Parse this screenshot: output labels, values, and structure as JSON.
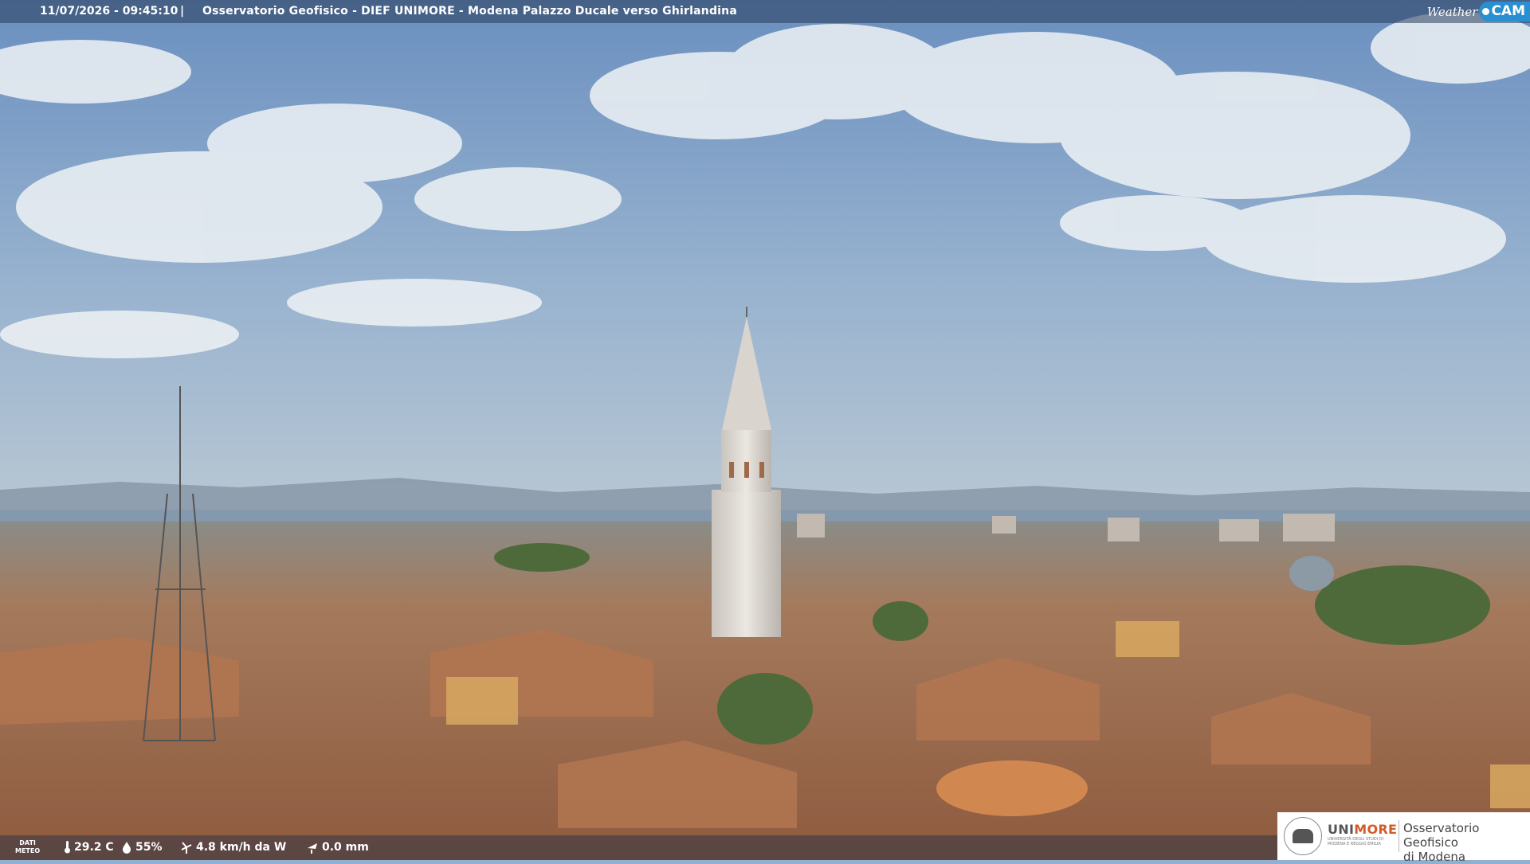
{
  "overlay": {
    "timestamp": "11/07/2026 - 09:45:10",
    "separator": "|",
    "title": "Osservatorio Geofisico - DIEF UNIMORE - Modena Palazzo Ducale verso Ghirlandina"
  },
  "brand": {
    "weather": "Weather",
    "cam": "CAM"
  },
  "meteo": {
    "label_line1": "DATI",
    "label_line2": "METEO",
    "temperature": "29.2 C",
    "humidity": "55%",
    "wind": "4.8 km/h da W",
    "rain": "0.0 mm"
  },
  "logo": {
    "uni_part1": "UNI",
    "uni_part2": "MORE",
    "uni_sub": "UNIVERSITÀ DEGLI STUDI DI MODENA E REGGIO EMILIA",
    "obs_line1": "Osservatorio Geofisico",
    "obs_line2": "di Modena"
  },
  "colors": {
    "sky_top": "#6f93c2",
    "sky_horizon": "#b9c9d6",
    "roofs": "#a86a4a",
    "accent": "#d35a2a"
  }
}
